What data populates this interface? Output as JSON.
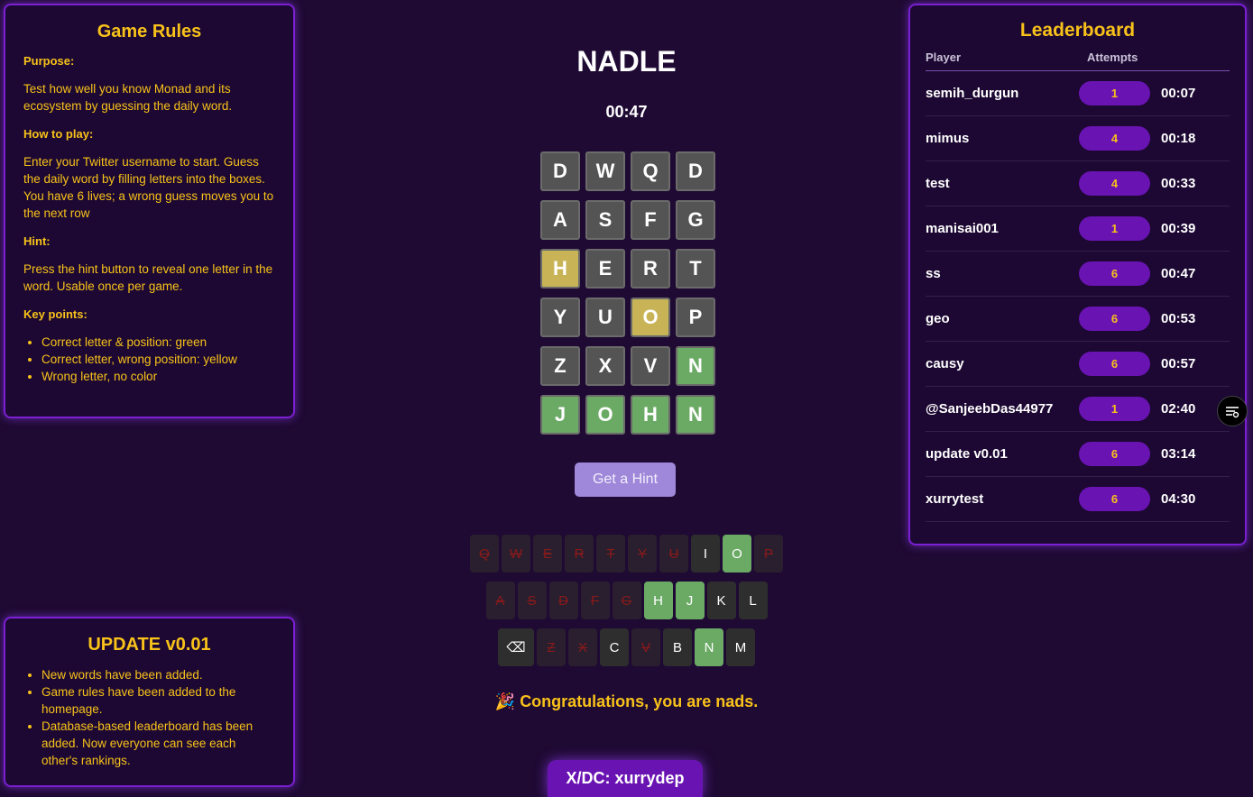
{
  "game": {
    "title": "NADLE",
    "timer": "00:47",
    "hint_button": "Get a Hint",
    "congrats_emoji": "🎉",
    "congrats_text": "Congratulations, you are nads.",
    "footer": "X/DC: xurrydep",
    "colors": {
      "correct": "#6aaa64",
      "present": "#c8b457",
      "absent": "#545454",
      "accent": "#f8c21a",
      "panel_border": "#7a1fd1"
    },
    "grid": [
      [
        {
          "letter": "D",
          "state": "gray"
        },
        {
          "letter": "W",
          "state": "gray"
        },
        {
          "letter": "Q",
          "state": "gray"
        },
        {
          "letter": "D",
          "state": "gray"
        }
      ],
      [
        {
          "letter": "A",
          "state": "gray"
        },
        {
          "letter": "S",
          "state": "gray"
        },
        {
          "letter": "F",
          "state": "gray"
        },
        {
          "letter": "G",
          "state": "gray"
        }
      ],
      [
        {
          "letter": "H",
          "state": "yellow"
        },
        {
          "letter": "E",
          "state": "gray"
        },
        {
          "letter": "R",
          "state": "gray"
        },
        {
          "letter": "T",
          "state": "gray"
        }
      ],
      [
        {
          "letter": "Y",
          "state": "gray"
        },
        {
          "letter": "U",
          "state": "gray"
        },
        {
          "letter": "O",
          "state": "yellow"
        },
        {
          "letter": "P",
          "state": "gray"
        }
      ],
      [
        {
          "letter": "Z",
          "state": "gray"
        },
        {
          "letter": "X",
          "state": "gray"
        },
        {
          "letter": "V",
          "state": "gray"
        },
        {
          "letter": "N",
          "state": "green"
        }
      ],
      [
        {
          "letter": "J",
          "state": "green"
        },
        {
          "letter": "O",
          "state": "green"
        },
        {
          "letter": "H",
          "state": "green"
        },
        {
          "letter": "N",
          "state": "green"
        }
      ]
    ],
    "keyboard": [
      [
        {
          "k": "Q",
          "s": "wrong"
        },
        {
          "k": "W",
          "s": "wrong"
        },
        {
          "k": "E",
          "s": "wrong"
        },
        {
          "k": "R",
          "s": "wrong"
        },
        {
          "k": "T",
          "s": "wrong"
        },
        {
          "k": "Y",
          "s": "wrong"
        },
        {
          "k": "U",
          "s": "wrong"
        },
        {
          "k": "I",
          "s": "dark"
        },
        {
          "k": "O",
          "s": "green"
        },
        {
          "k": "P",
          "s": "wrong"
        }
      ],
      [
        {
          "k": "A",
          "s": "wrong"
        },
        {
          "k": "S",
          "s": "wrong"
        },
        {
          "k": "D",
          "s": "wrong"
        },
        {
          "k": "F",
          "s": "wrong"
        },
        {
          "k": "G",
          "s": "wrong"
        },
        {
          "k": "H",
          "s": "green"
        },
        {
          "k": "J",
          "s": "green"
        },
        {
          "k": "K",
          "s": "dark"
        },
        {
          "k": "L",
          "s": "dark"
        }
      ],
      [
        {
          "k": "⌫",
          "s": "dark",
          "wide": true
        },
        {
          "k": "Z",
          "s": "wrong"
        },
        {
          "k": "X",
          "s": "wrong"
        },
        {
          "k": "C",
          "s": "dark"
        },
        {
          "k": "V",
          "s": "wrong"
        },
        {
          "k": "B",
          "s": "dark"
        },
        {
          "k": "N",
          "s": "green"
        },
        {
          "k": "M",
          "s": "dark"
        }
      ]
    ]
  },
  "rules": {
    "title": "Game Rules",
    "purpose_heading": "Purpose:",
    "purpose_text": "Test how well you know Monad and its ecosystem by guessing the daily word.",
    "howto_heading": "How to play:",
    "howto_text": "Enter your Twitter username to start. Guess the daily word by filling letters into the boxes. You have 6 lives; a wrong guess moves you to the next row",
    "hint_heading": "Hint:",
    "hint_text": "Press the hint button to reveal one letter in the word. Usable once per game.",
    "keypoints_heading": "Key points:",
    "keypoints": [
      "Correct letter & position: green",
      "Correct letter, wrong position: yellow",
      "Wrong letter, no color"
    ]
  },
  "update": {
    "title": "UPDATE v0.01",
    "items": [
      "New words have been added.",
      "Game rules have been added to the homepage.",
      "Database-based leaderboard has been added. Now everyone can see each other's rankings."
    ]
  },
  "leaderboard": {
    "title": "Leaderboard",
    "col_player": "Player",
    "col_attempts": "Attempts",
    "rows": [
      {
        "player": "semih_durgun",
        "attempts": "1",
        "time": "00:07"
      },
      {
        "player": "mimus",
        "attempts": "4",
        "time": "00:18"
      },
      {
        "player": "test",
        "attempts": "4",
        "time": "00:33"
      },
      {
        "player": "manisai001",
        "attempts": "1",
        "time": "00:39"
      },
      {
        "player": "ss",
        "attempts": "6",
        "time": "00:47"
      },
      {
        "player": "geo",
        "attempts": "6",
        "time": "00:53"
      },
      {
        "player": "causy",
        "attempts": "6",
        "time": "00:57"
      },
      {
        "player": "@SanjeebDas44977",
        "attempts": "1",
        "time": "02:40"
      },
      {
        "player": "update v0.01",
        "attempts": "6",
        "time": "03:14"
      },
      {
        "player": "xurrytest",
        "attempts": "6",
        "time": "04:30"
      }
    ]
  },
  "floating_button_icon": "filter-settings-icon"
}
